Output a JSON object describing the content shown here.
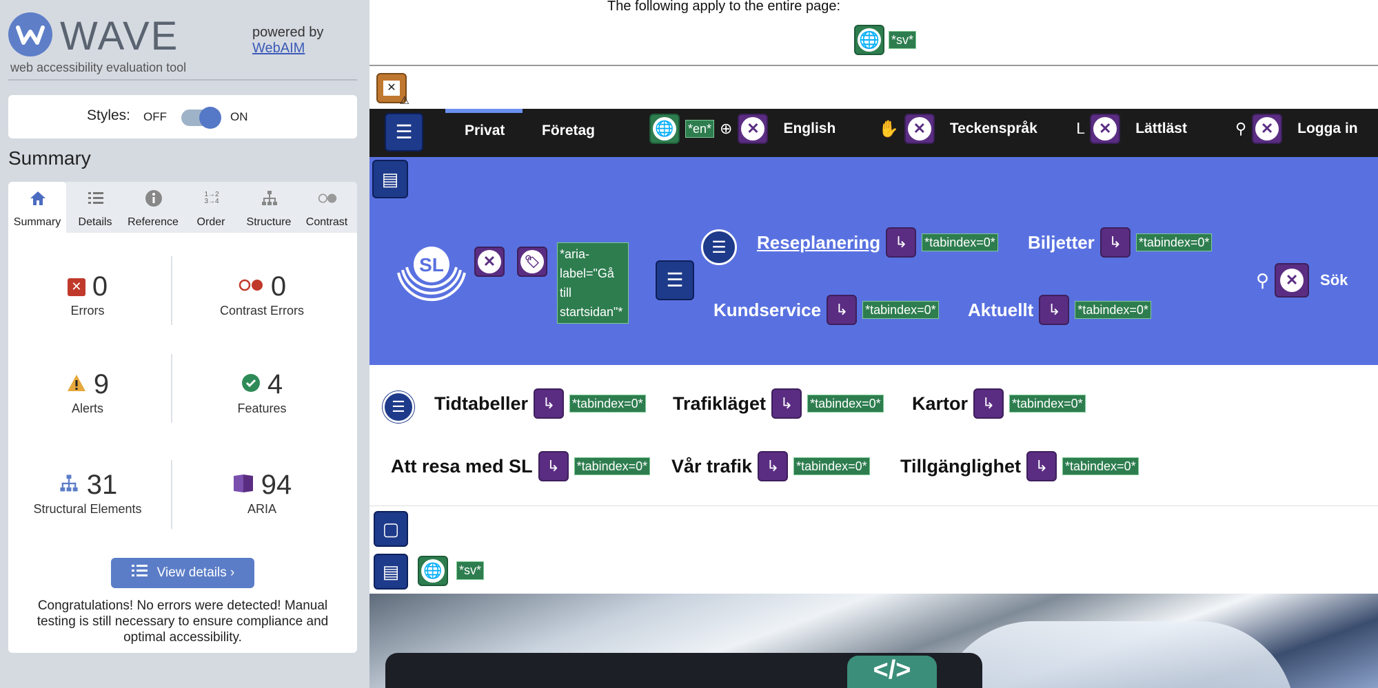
{
  "wave": {
    "logo_text": "WAVE",
    "tagline": "web accessibility evaluation tool",
    "powered_by": "powered by",
    "webaim_link": "WebAIM",
    "styles_label": "Styles:",
    "toggle_off": "OFF",
    "toggle_on": "ON",
    "summary_heading": "Summary",
    "tabs": [
      {
        "label": "Summary",
        "icon": "home-icon"
      },
      {
        "label": "Details",
        "icon": "list-icon"
      },
      {
        "label": "Reference",
        "icon": "info-icon"
      },
      {
        "label": "Order",
        "icon": "order-icon"
      },
      {
        "label": "Structure",
        "icon": "structure-icon"
      },
      {
        "label": "Contrast",
        "icon": "contrast-icon"
      }
    ],
    "stats": {
      "errors": {
        "count": "0",
        "label": "Errors",
        "color": "#c0392b"
      },
      "contrast_errors": {
        "count": "0",
        "label": "Contrast Errors",
        "color": "#c0392b"
      },
      "alerts": {
        "count": "9",
        "label": "Alerts",
        "color": "#e5a83b"
      },
      "features": {
        "count": "4",
        "label": "Features",
        "color": "#2e8b57"
      },
      "structural": {
        "count": "31",
        "label": "Structural Elements",
        "color": "#5b7dc7"
      },
      "aria": {
        "count": "94",
        "label": "ARIA",
        "color": "#5a2d82"
      }
    },
    "view_details": "View details ›",
    "congrats": "Congratulations! No errors were detected! Manual testing is still necessary to ensure compliance and optimal accessibility."
  },
  "page": {
    "note": "The following apply to the entire page:",
    "lang_tag": "*sv*",
    "nav": {
      "privat": "Privat",
      "foretag": "Företag",
      "en_tag": "*en*",
      "english": "English",
      "teckensprak": "Teckenspråk",
      "lattlast": "Lättläst",
      "logga_in": "Logga in"
    },
    "hero": {
      "logo_text": "SL",
      "aria_label_tag": "*aria-label=\"Gå till startsidan\"*",
      "links": [
        {
          "label": "Reseplanering",
          "tag": "*tabindex=0*"
        },
        {
          "label": "Biljetter",
          "tag": "*tabindex=0*"
        },
        {
          "label": "Kundservice",
          "tag": "*tabindex=0*"
        },
        {
          "label": "Aktuellt",
          "tag": "*tabindex=0*"
        }
      ],
      "search": "Sök"
    },
    "submenu": [
      {
        "label": "Tidtabeller",
        "tag": "*tabindex=0*"
      },
      {
        "label": "Trafikläget",
        "tag": "*tabindex=0*"
      },
      {
        "label": "Kartor",
        "tag": "*tabindex=0*"
      },
      {
        "label": "Att resa med SL",
        "tag": "*tabindex=0*"
      },
      {
        "label": "Vår trafik",
        "tag": "*tabindex=0*"
      },
      {
        "label": "Tillgänglighet",
        "tag": "*tabindex=0*"
      }
    ],
    "lower_lang_tag": "*sv*",
    "code_badge": "</>"
  }
}
